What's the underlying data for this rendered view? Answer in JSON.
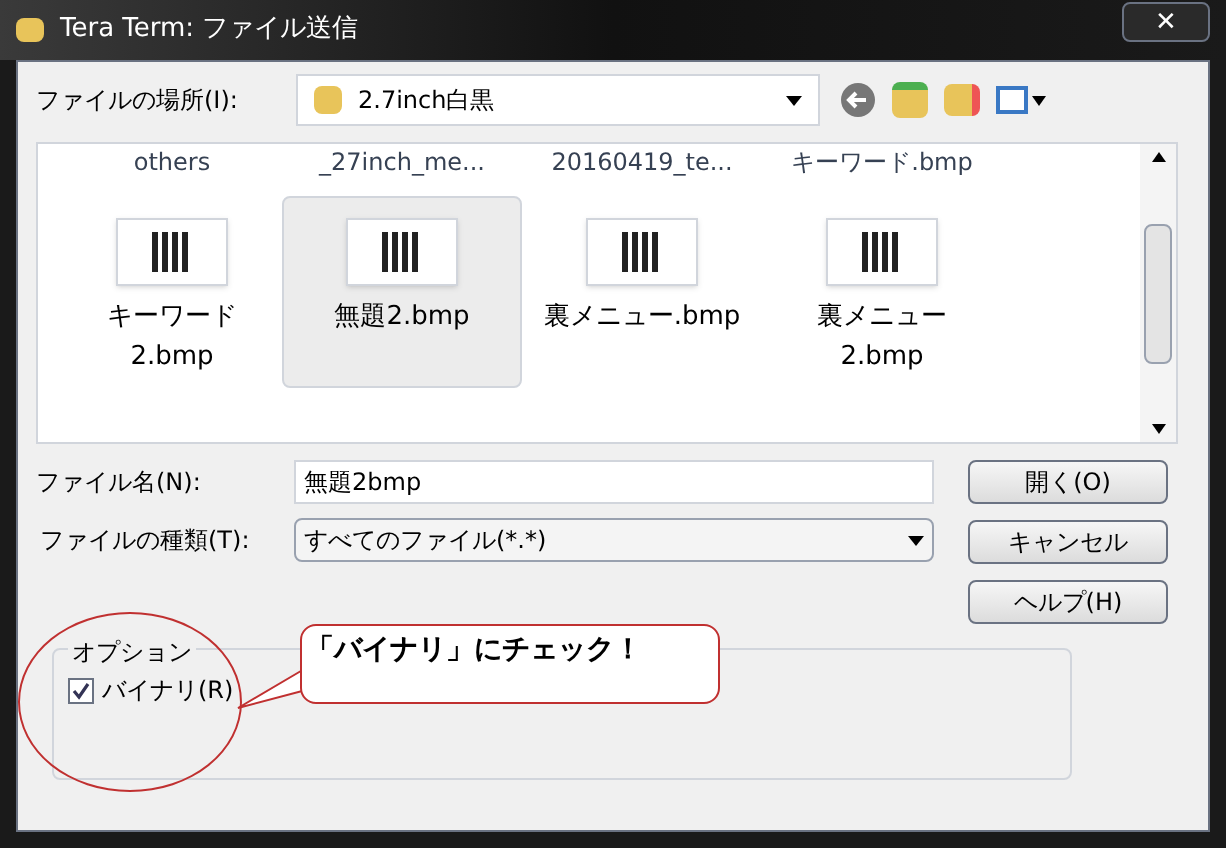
{
  "window": {
    "title": "Tera Term: ファイル送信",
    "close": "✕"
  },
  "location": {
    "label": "ファイルの場所(I):",
    "value": "2.7inch白黒"
  },
  "file_list": {
    "cut_row": [
      "others",
      "_27inch_me...",
      "20160419_te...",
      "キーワード.bmp"
    ],
    "items": [
      {
        "name": "キーワード\n2.bmp",
        "selected": false
      },
      {
        "name": "無題2.bmp",
        "selected": true
      },
      {
        "name": "裏メニュー.bmp",
        "selected": false
      },
      {
        "name": "裏メニュー\n2.bmp",
        "selected": false
      }
    ]
  },
  "file_name": {
    "label": "ファイル名(N):",
    "value": "無題2bmp"
  },
  "file_type": {
    "label": "ファイルの種類(T):",
    "value": "すべてのファイル(*.*)"
  },
  "buttons": [
    "開く(O)",
    "キャンセル",
    "ヘルプ(H)"
  ],
  "options": {
    "title": "オプション",
    "binary": {
      "label": "バイナリ(R)",
      "checked": true
    }
  },
  "callout": {
    "text": "「バイナリ」にチェック！"
  }
}
